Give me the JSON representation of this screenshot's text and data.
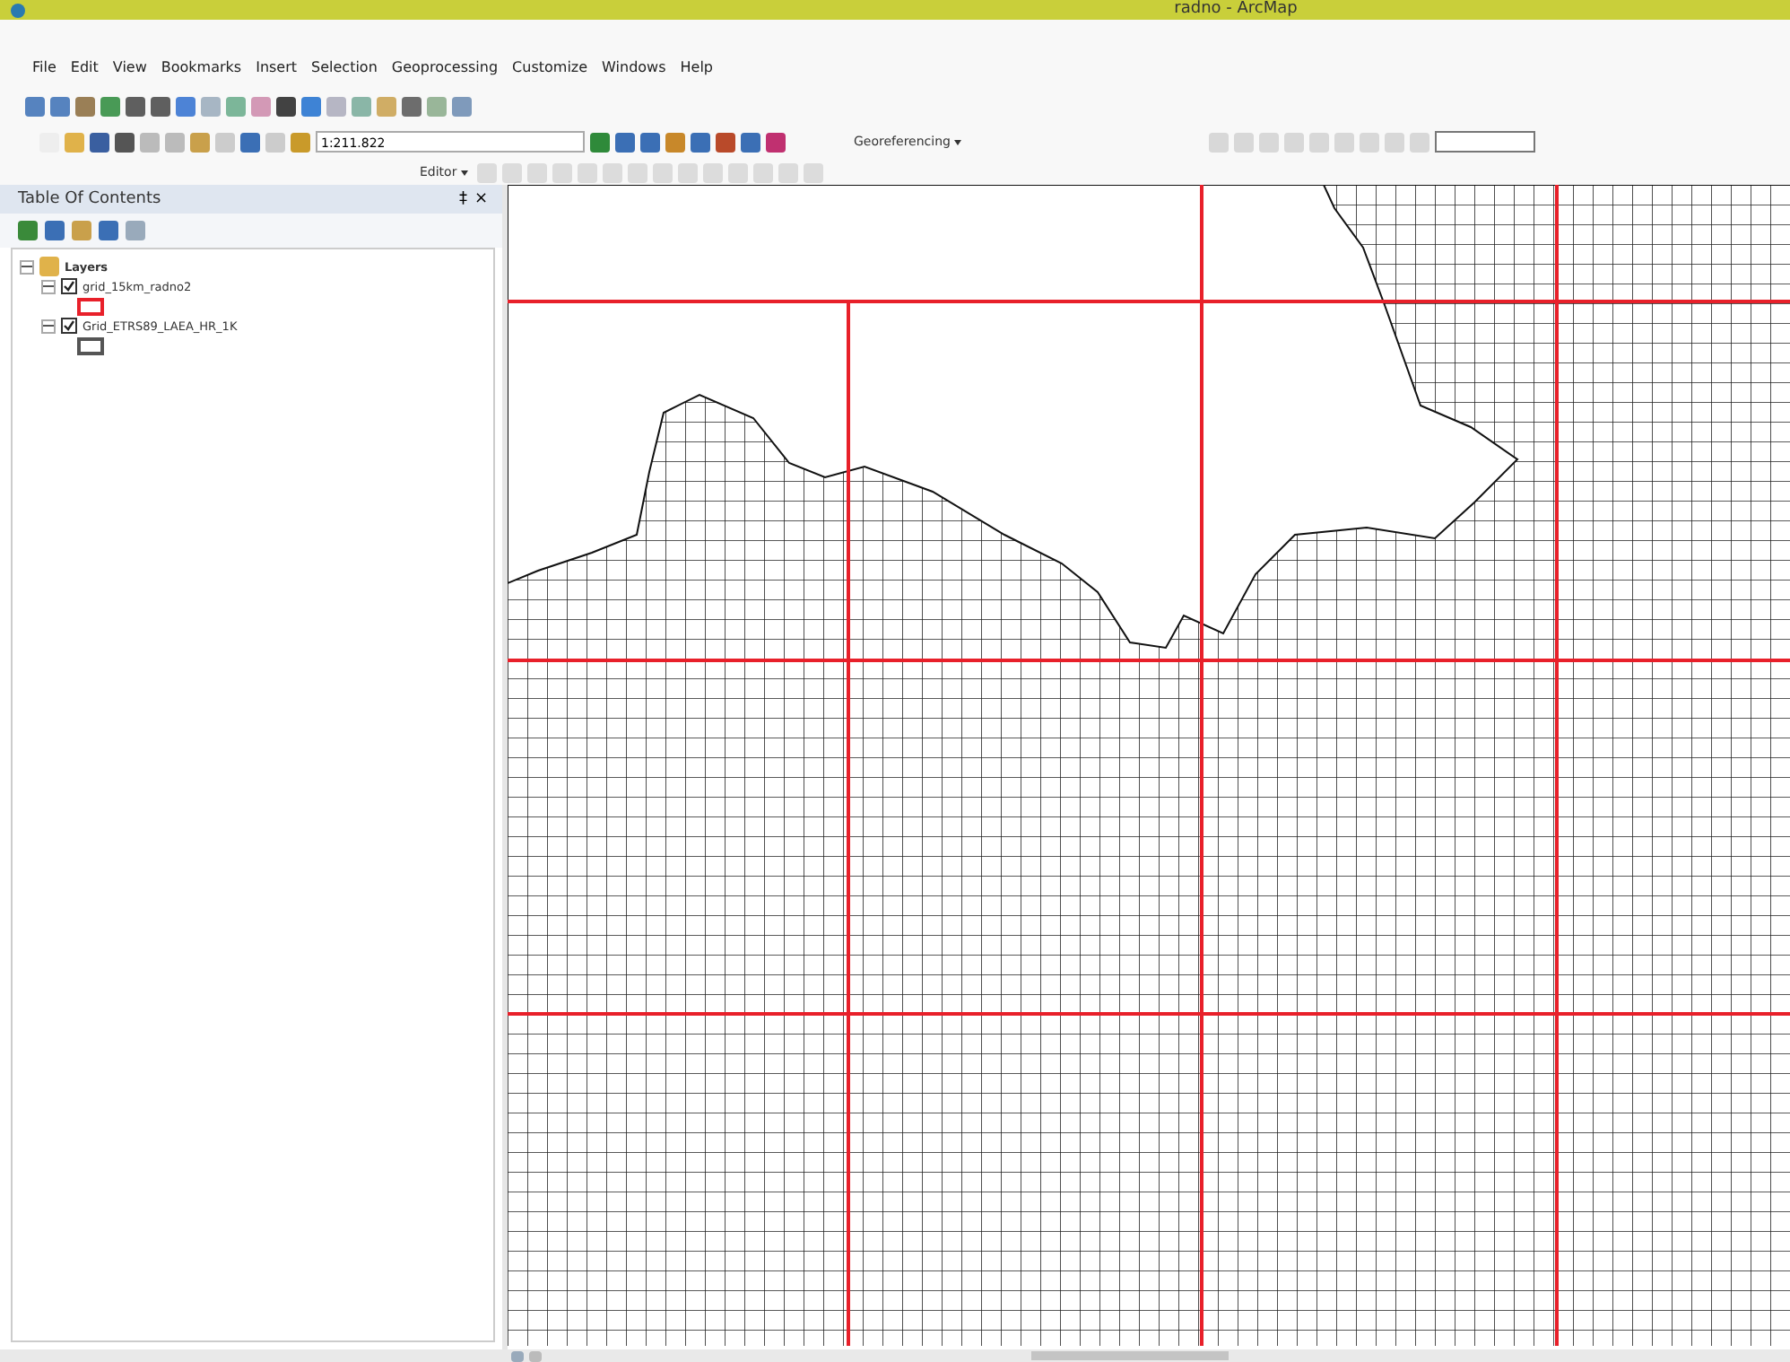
{
  "window": {
    "title": "radno - ArcMap"
  },
  "menu": [
    "File",
    "Edit",
    "View",
    "Bookmarks",
    "Insert",
    "Selection",
    "Geoprocessing",
    "Customize",
    "Windows",
    "Help"
  ],
  "toolbar": {
    "scale": "1:211.822",
    "editor": "Editor",
    "georeferencing": "Georeferencing"
  },
  "toc": {
    "title": "Table Of Contents",
    "pin": "‡",
    "close": "×",
    "tree": [
      {
        "label": "Layers",
        "expanded": true,
        "children": [
          {
            "label": "grid_15km_radno2",
            "checked": true,
            "expanded": true,
            "color": "#e8202a"
          },
          {
            "label": "Grid_ETRS89_LAEA_HR_1K",
            "checked": true,
            "expanded": true,
            "color": "#555555"
          }
        ]
      }
    ]
  }
}
